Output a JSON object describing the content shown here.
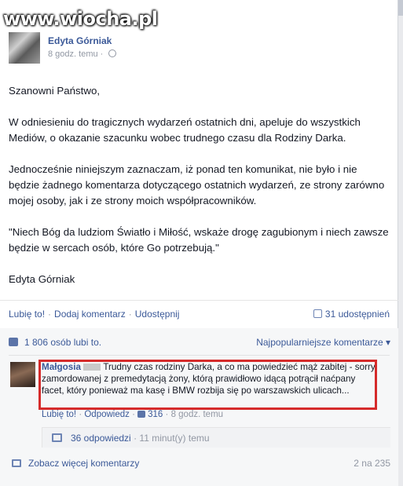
{
  "watermark": {
    "text": "www.wiocha.pl"
  },
  "post": {
    "author": "Edyta Górniak",
    "timestamp": "8 godz. temu",
    "paragraphs": [
      "Szanowni Państwo,",
      "W odniesieniu do tragicznych wydarzeń ostatnich dni, apeluje do wszystkich Mediów, o okazanie szacunku wobec trudnego czasu dla Rodziny Darka.",
      "Jednocześnie niniejszym zaznaczam, iż ponad ten komunikat, nie było i nie będzie żadnego komentarza dotyczącego ostatnich wydarzeń, ze strony zarówno mojej osoby, jak i ze strony moich współpracowników.",
      "\"Niech Bóg da ludziom Światło i Miłość, wskaże drogę zagubionym i niech zawsze będzie w sercach osób, które Go potrzebują.\"",
      "Edyta Górniak"
    ]
  },
  "actions": {
    "like": "Lubię to!",
    "comment": "Dodaj komentarz",
    "share": "Udostępnij",
    "shares_count": "31 udostępnień"
  },
  "ufi": {
    "likes_text": "1 806 osób lubi to.",
    "sort_label": "Najpopularniejsze komentarze ▾"
  },
  "comment": {
    "author": "Małgosia",
    "text": "Trudny czas rodziny Darka, a co ma powiedzieć mąż zabitej - sorry zamordowanej z premedytacją żony, którą prawidłowo idącą potrącił naćpany facet, który ponieważ ma kasę i BMW rozbija się po warszawskich ulicach...",
    "like": "Lubię to!",
    "reply": "Odpowiedz",
    "likes": "316",
    "time": "8 godz. temu"
  },
  "replies": {
    "count_text": "36 odpowiedzi",
    "time": "11 minut(y) temu"
  },
  "more": {
    "label": "Zobacz więcej komentarzy",
    "count": "2 na 235"
  },
  "colors": {
    "link": "#3b5998",
    "highlight": "#d52b2b",
    "muted": "#9197a3"
  }
}
